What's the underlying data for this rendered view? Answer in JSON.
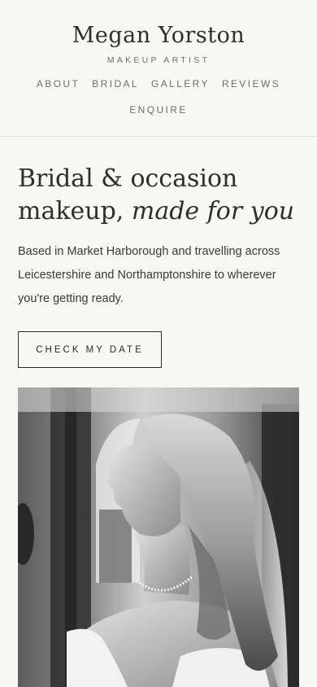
{
  "header": {
    "brand_name": "Megan Yorston",
    "brand_tagline": "MAKEUP ARTIST",
    "nav": {
      "about": "ABOUT",
      "bridal": "BRIDAL",
      "gallery": "GALLERY",
      "reviews": "REVIEWS",
      "enquire": "ENQUIRE"
    }
  },
  "hero": {
    "title_line1": "Bridal & occasion",
    "title_line2_plain": "makeup, ",
    "title_line2_italic": "made for you",
    "description": "Based in Market Harborough and travelling across Leicestershire and Northamptonshire to wherever you're getting ready.",
    "cta_label": "CHECK MY DATE"
  },
  "colors": {
    "background": "#f8f7f4",
    "text": "#2b2a28",
    "muted": "#6f6d69"
  }
}
